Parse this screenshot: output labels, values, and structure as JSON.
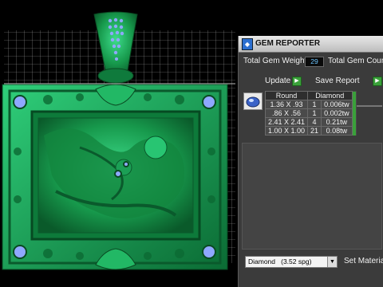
{
  "panel": {
    "title": "GEM REPORTER",
    "total_gem_weight_label": "Total Gem Weight",
    "total_gem_weight_value": "29",
    "total_gem_count_label": "Total Gem Count",
    "update_label": "Update",
    "save_report_label": "Save Report",
    "table": {
      "headers": [
        "Round",
        "Diamond"
      ],
      "rows": [
        {
          "size": "1.36 X .93",
          "count": "1",
          "weight": "0.006tw"
        },
        {
          "size": ".86 X .56",
          "count": "1",
          "weight": "0.002tw"
        },
        {
          "size": "2.41 X 2.41",
          "count": "4",
          "weight": "0.21tw"
        },
        {
          "size": "1.00 X 1.00",
          "count": "21",
          "weight": "0.08tw"
        }
      ]
    },
    "material_select": {
      "value": "Diamond",
      "density": "(3.52 spg)"
    },
    "set_material_label": "Set Material"
  },
  "colors": {
    "jewel_green": "#1fa85a",
    "stone_blue": "#8fa8ff",
    "panel_bg": "#3b3b3b",
    "accent_green": "#3aa13a"
  },
  "icons": [
    "gem-reporter-icon",
    "gem-thumbnail-icon",
    "chevron-down-icon"
  ]
}
